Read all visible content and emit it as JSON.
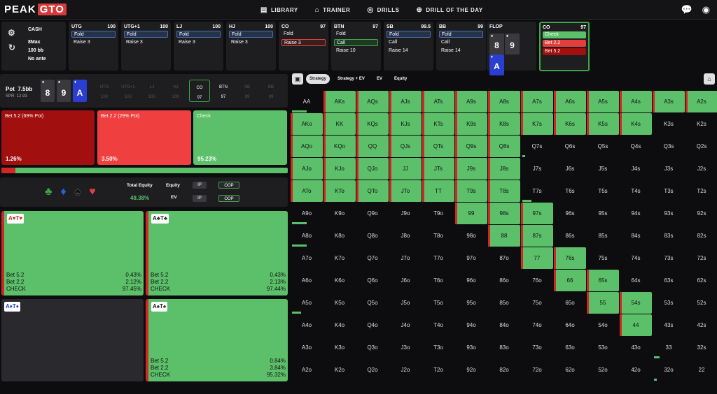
{
  "brand": {
    "a": "PEAK",
    "b": "GTO"
  },
  "nav": [
    "LIBRARY",
    "TRAINER",
    "DRILLS",
    "DRILL OF THE DAY"
  ],
  "game": {
    "type": "CASH",
    "max": "8Max",
    "stack": "100 bb",
    "ante": "No ante"
  },
  "positions": [
    {
      "name": "UTG",
      "stack": "100",
      "actions": [
        {
          "t": "Fold",
          "s": "sel"
        },
        {
          "t": "Raise 3",
          "s": ""
        }
      ]
    },
    {
      "name": "UTG+1",
      "stack": "100",
      "actions": [
        {
          "t": "Fold",
          "s": "sel"
        },
        {
          "t": "Raise 3",
          "s": ""
        }
      ]
    },
    {
      "name": "LJ",
      "stack": "100",
      "actions": [
        {
          "t": "Fold",
          "s": "sel"
        },
        {
          "t": "Raise 3",
          "s": ""
        }
      ]
    },
    {
      "name": "HJ",
      "stack": "100",
      "actions": [
        {
          "t": "Fold",
          "s": "sel"
        },
        {
          "t": "Raise 3",
          "s": ""
        }
      ]
    },
    {
      "name": "CO",
      "stack": "97",
      "actions": [
        {
          "t": "Fold",
          "s": ""
        },
        {
          "t": "Raise 3",
          "s": "selr"
        }
      ]
    },
    {
      "name": "BTN",
      "stack": "97",
      "actions": [
        {
          "t": "Fold",
          "s": ""
        },
        {
          "t": "Call",
          "s": "selg"
        },
        {
          "t": "Raise 10",
          "s": ""
        }
      ]
    },
    {
      "name": "SB",
      "stack": "99.5",
      "actions": [
        {
          "t": "Fold",
          "s": "sel"
        },
        {
          "t": "Call",
          "s": ""
        },
        {
          "t": "Raise 14",
          "s": ""
        }
      ]
    },
    {
      "name": "BB",
      "stack": "99",
      "actions": [
        {
          "t": "Fold",
          "s": "sel"
        },
        {
          "t": "Call",
          "s": ""
        },
        {
          "t": "Raise 14",
          "s": ""
        }
      ]
    }
  ],
  "flop": {
    "label": "FLOP",
    "cards": [
      {
        "r": "8",
        "s": "♠",
        "c": "grey"
      },
      {
        "r": "9",
        "s": "♠",
        "c": "grey"
      },
      {
        "r": "A",
        "s": "♦",
        "c": "blue"
      }
    ]
  },
  "current": {
    "name": "CO",
    "stack": "97",
    "actions": [
      {
        "t": "Check",
        "c": "#5cbf69"
      },
      {
        "t": "Bet 2.2",
        "c": "#e53e3e"
      },
      {
        "t": "Bet 5.2",
        "c": "#a10f0f"
      }
    ]
  },
  "pot": {
    "label": "Pot",
    "value": "7.5bb",
    "spr": "SPR: 12.93"
  },
  "seats": [
    {
      "n": "UTG",
      "s": "100",
      "a": false
    },
    {
      "n": "UTG+1",
      "s": "100",
      "a": false
    },
    {
      "n": "LJ",
      "s": "100",
      "a": false
    },
    {
      "n": "HJ",
      "s": "100",
      "a": false
    },
    {
      "n": "CO",
      "s": "97",
      "a": true
    },
    {
      "n": "BTN",
      "s": "97",
      "a": true
    },
    {
      "n": "SB",
      "s": "99",
      "a": false
    },
    {
      "n": "BB",
      "s": "99",
      "a": false
    }
  ],
  "bets": [
    {
      "label": "Bet 5.2 (69% Pot)",
      "pct": "1.26%",
      "color": "#a10f0f"
    },
    {
      "label": "Bet 2.2 (29% Pot)",
      "pct": "3.50%",
      "color": "#ef3f3f"
    },
    {
      "label": "Check",
      "pct": "95.23%",
      "color": "#5cbf69"
    }
  ],
  "freq_red": 0.048,
  "equity": {
    "title": "Total Equity",
    "value": "48.38%",
    "eq": "Equity",
    "ev": "EV",
    "ip": "IP",
    "oop": "OOP"
  },
  "hands": [
    {
      "tag": "A♥T♥",
      "cls": "",
      "g": true,
      "lines": [
        [
          "Bet 5.2",
          "0.43%"
        ],
        [
          "Bet 2.2",
          "2.12%"
        ],
        [
          "CHECK",
          "97.45%"
        ]
      ]
    },
    {
      "tag": "A♣T♣",
      "cls": "blk",
      "g": true,
      "lines": [
        [
          "Bet 5.2",
          "0.43%"
        ],
        [
          "Bet 2.2",
          "2.13%"
        ],
        [
          "CHECK",
          "97.44%"
        ]
      ]
    },
    {
      "tag": "A♦T♦",
      "cls": "blu",
      "g": false,
      "lines": []
    },
    {
      "tag": "A♠T♠",
      "cls": "blk",
      "g": true,
      "lines": [
        [
          "Bet 5.2",
          "0.84%"
        ],
        [
          "Bet 2.2",
          "3.84%"
        ],
        [
          "CHECK",
          "95.32%"
        ]
      ]
    }
  ],
  "tabs": [
    "Strategy",
    "Strategy + EV",
    "EV",
    "Equity"
  ],
  "matrix": [
    [
      "AA",
      "AKs",
      "AQs",
      "AJs",
      "ATs",
      "A9s",
      "A8s",
      "A7s",
      "A6s",
      "A5s",
      "A4s",
      "A3s",
      "A2s"
    ],
    [
      "AKo",
      "KK",
      "KQs",
      "KJs",
      "KTs",
      "K9s",
      "K8s",
      "K7s",
      "K6s",
      "K5s",
      "K4s",
      "K3s",
      "K2s"
    ],
    [
      "AQo",
      "KQo",
      "QQ",
      "QJs",
      "QTs",
      "Q9s",
      "Q8s",
      "Q7s",
      "Q6s",
      "Q5s",
      "Q4s",
      "Q3s",
      "Q2s"
    ],
    [
      "AJo",
      "KJo",
      "QJo",
      "JJ",
      "JTs",
      "J9s",
      "J8s",
      "J7s",
      "J6s",
      "J5s",
      "J4s",
      "J3s",
      "J2s"
    ],
    [
      "ATo",
      "KTo",
      "QTo",
      "JTo",
      "TT",
      "T9s",
      "T8s",
      "T7s",
      "T6s",
      "T5s",
      "T4s",
      "T3s",
      "T2s"
    ],
    [
      "A9o",
      "K9o",
      "Q9o",
      "J9o",
      "T9o",
      "99",
      "98s",
      "97s",
      "96s",
      "95s",
      "94s",
      "93s",
      "92s"
    ],
    [
      "A8o",
      "K8o",
      "Q8o",
      "J8o",
      "T8o",
      "98o",
      "88",
      "87s",
      "86s",
      "85s",
      "84s",
      "83s",
      "82s"
    ],
    [
      "A7o",
      "K7o",
      "Q7o",
      "J7o",
      "T7o",
      "97o",
      "87o",
      "77",
      "76s",
      "75s",
      "74s",
      "73s",
      "72s"
    ],
    [
      "A6o",
      "K6o",
      "Q6o",
      "J6o",
      "T6o",
      "96o",
      "86o",
      "76o",
      "66",
      "65s",
      "64s",
      "63s",
      "62s"
    ],
    [
      "A5o",
      "K5o",
      "Q5o",
      "J5o",
      "T5o",
      "95o",
      "85o",
      "75o",
      "65o",
      "55",
      "54s",
      "53s",
      "52s"
    ],
    [
      "A4o",
      "K4o",
      "Q4o",
      "J4o",
      "T4o",
      "94o",
      "84o",
      "74o",
      "64o",
      "54o",
      "44",
      "43s",
      "42s"
    ],
    [
      "A3o",
      "K3o",
      "Q3o",
      "J3o",
      "T3o",
      "93o",
      "83o",
      "73o",
      "63o",
      "53o",
      "43o",
      "33",
      "32s"
    ],
    [
      "A2o",
      "K2o",
      "Q2o",
      "J2o",
      "T2o",
      "92o",
      "82o",
      "72o",
      "62o",
      "52o",
      "42o",
      "32o",
      "22"
    ]
  ],
  "matrix_fill": [
    [
      0.5,
      1,
      1,
      1,
      1,
      1,
      1,
      1,
      1,
      1,
      1,
      1,
      1
    ],
    [
      1,
      1,
      1,
      1,
      1,
      1,
      1,
      1,
      1,
      1,
      1,
      0,
      0
    ],
    [
      1,
      1,
      1,
      1,
      1,
      1,
      1,
      0.1,
      0,
      0,
      0,
      0,
      0
    ],
    [
      1,
      1,
      1,
      1,
      1,
      1,
      1,
      0,
      0,
      0,
      0,
      0,
      0
    ],
    [
      1,
      1,
      1,
      1,
      1,
      1,
      1,
      0.3,
      0,
      0,
      0,
      0,
      0
    ],
    [
      0.5,
      0,
      0,
      0,
      0,
      1,
      1,
      1,
      0,
      0,
      0,
      0,
      0
    ],
    [
      0.5,
      0,
      0,
      0,
      0,
      0,
      1,
      1,
      0,
      0,
      0,
      0,
      0
    ],
    [
      0,
      0,
      0,
      0,
      0,
      0,
      0,
      1,
      1,
      0,
      0,
      0,
      0
    ],
    [
      0,
      0,
      0,
      0,
      0,
      0,
      0,
      0,
      1,
      1,
      0,
      0,
      0
    ],
    [
      0.3,
      0,
      0,
      0,
      0,
      0,
      0,
      0,
      0,
      1,
      1,
      0,
      0
    ],
    [
      0,
      0,
      0,
      0,
      0,
      0,
      0,
      0,
      0,
      0,
      1,
      0,
      0
    ],
    [
      0,
      0,
      0,
      0,
      0,
      0,
      0,
      0,
      0,
      0,
      0,
      0.2,
      0
    ],
    [
      0,
      0,
      0,
      0,
      0,
      0,
      0,
      0,
      0,
      0,
      0,
      0.1,
      0
    ]
  ]
}
